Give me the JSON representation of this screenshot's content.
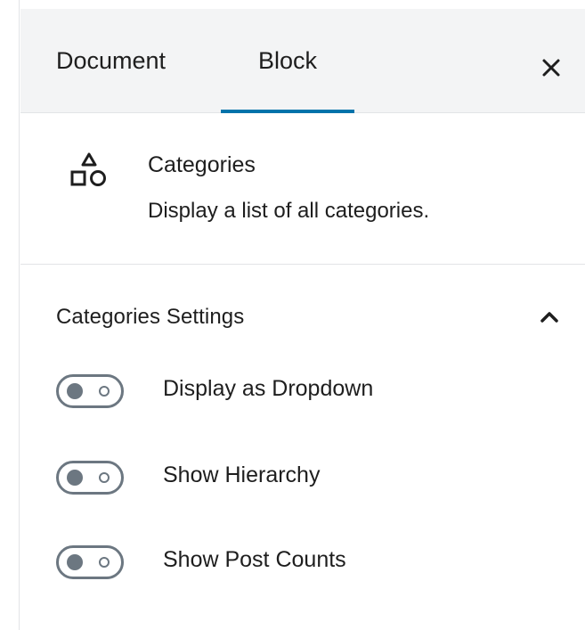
{
  "tabs": {
    "document_label": "Document",
    "block_label": "Block",
    "active": "Block"
  },
  "close_icon": "close-icon",
  "block": {
    "icon": "shapes-icon",
    "title": "Categories",
    "description": "Display a list of all categories."
  },
  "settings": {
    "title": "Categories Settings",
    "expanded": true,
    "toggles": [
      {
        "label": "Display as Dropdown",
        "checked": false
      },
      {
        "label": "Show Hierarchy",
        "checked": false
      },
      {
        "label": "Show Post Counts",
        "checked": false
      }
    ]
  },
  "colors": {
    "accent": "#0073aa",
    "header_bg": "#f3f4f5",
    "toggle_gray": "#6c7781",
    "text": "#1e1e1e"
  }
}
